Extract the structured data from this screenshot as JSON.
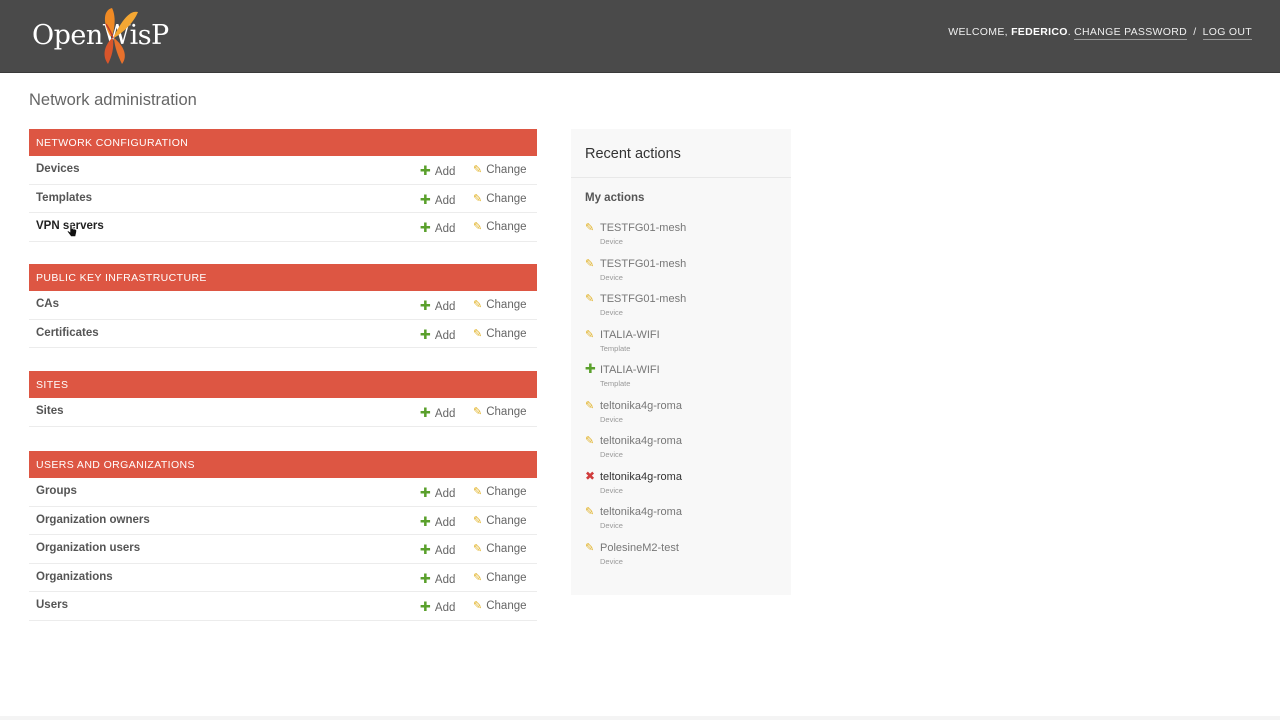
{
  "header": {
    "logo_text": "OpenWisP",
    "welcome": "WELCOME,",
    "username": "FEDERICO",
    "change_password": "CHANGE PASSWORD",
    "separator": "/",
    "logout": "LOG OUT"
  },
  "page_title": "Network administration",
  "modules": [
    {
      "title": "NETWORK CONFIGURATION",
      "rows": [
        {
          "label": "Devices",
          "add": "Add",
          "change": "Change"
        },
        {
          "label": "Templates",
          "add": "Add",
          "change": "Change"
        },
        {
          "label": "VPN servers",
          "add": "Add",
          "change": "Change"
        }
      ]
    },
    {
      "title": "PUBLIC KEY INFRASTRUCTURE",
      "rows": [
        {
          "label": "CAs",
          "add": "Add",
          "change": "Change"
        },
        {
          "label": "Certificates",
          "add": "Add",
          "change": "Change"
        }
      ]
    },
    {
      "title": "SITES",
      "rows": [
        {
          "label": "Sites",
          "add": "Add",
          "change": "Change"
        }
      ]
    },
    {
      "title": "USERS AND ORGANIZATIONS",
      "rows": [
        {
          "label": "Groups",
          "add": "Add",
          "change": "Change"
        },
        {
          "label": "Organization owners",
          "add": "Add",
          "change": "Change"
        },
        {
          "label": "Organization users",
          "add": "Add",
          "change": "Change"
        },
        {
          "label": "Organizations",
          "add": "Add",
          "change": "Change"
        },
        {
          "label": "Users",
          "add": "Add",
          "change": "Change"
        }
      ]
    }
  ],
  "recent_actions": {
    "title": "Recent actions",
    "subtitle": "My actions",
    "items": [
      {
        "action": "change",
        "name": "TESTFG01-mesh",
        "type": "Device"
      },
      {
        "action": "change",
        "name": "TESTFG01-mesh",
        "type": "Device"
      },
      {
        "action": "change",
        "name": "TESTFG01-mesh",
        "type": "Device"
      },
      {
        "action": "change",
        "name": "ITALIA-WIFI",
        "type": "Template"
      },
      {
        "action": "add",
        "name": "ITALIA-WIFI",
        "type": "Template"
      },
      {
        "action": "change",
        "name": "teltonika4g-roma",
        "type": "Device"
      },
      {
        "action": "change",
        "name": "teltonika4g-roma",
        "type": "Device"
      },
      {
        "action": "delete",
        "name": "teltonika4g-roma",
        "type": "Device"
      },
      {
        "action": "change",
        "name": "teltonika4g-roma",
        "type": "Device"
      },
      {
        "action": "change",
        "name": "PolesineM2-test",
        "type": "Device"
      }
    ]
  },
  "icons": {
    "add": "plus-icon",
    "change": "pencil-icon",
    "delete": "delete-x-icon",
    "cursor": "hand-pointer-icon"
  },
  "colors": {
    "header_bg": "#4a4a4a",
    "module_header_bg": "#dd5643",
    "add_green": "#5aa02c",
    "change_yellow": "#e0b020",
    "delete_red": "#d03c3c",
    "recent_bg": "#f8f8f8"
  }
}
